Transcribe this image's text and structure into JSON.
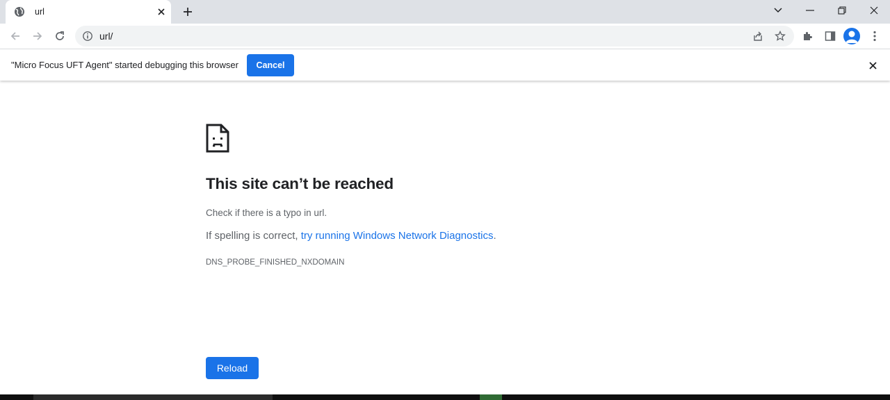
{
  "tab": {
    "title": "url",
    "favicon": "globe-icon"
  },
  "address_bar": {
    "url": "url/"
  },
  "infobar": {
    "message": "\"Micro Focus UFT Agent\" started debugging this browser",
    "cancel_label": "Cancel"
  },
  "error_page": {
    "icon": "sad-document-icon",
    "title": "This site can’t be reached",
    "line1": "Check if there is a typo in url.",
    "line2_prefix": "If spelling is correct, ",
    "line2_link": "try running Windows Network Diagnostics",
    "line2_suffix": ".",
    "error_code": "DNS_PROBE_FINISHED_NXDOMAIN",
    "reload_label": "Reload"
  },
  "colors": {
    "accent": "#1a73e8",
    "tabstrip": "#dee1e6",
    "omnibox": "#f1f3f4",
    "text_secondary": "#5f6368"
  }
}
